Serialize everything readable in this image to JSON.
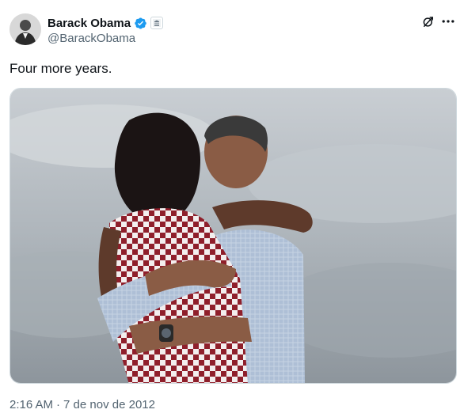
{
  "author": {
    "display_name": "Barack Obama",
    "handle": "@BarackObama",
    "verified": true,
    "affiliation_badge": "government-seal-icon"
  },
  "actions": {
    "grok_icon": "grok-icon",
    "more_icon": "more-options-icon"
  },
  "tweet": {
    "text": "Four more years.",
    "media_description": "photo"
  },
  "meta": {
    "time": "2:16 AM",
    "separator": "·",
    "date": "7 de nov de 2012"
  },
  "colors": {
    "text_primary": "#0f1419",
    "text_secondary": "#536471",
    "verified_blue": "#1d9bf0",
    "border": "#cfd9de"
  }
}
